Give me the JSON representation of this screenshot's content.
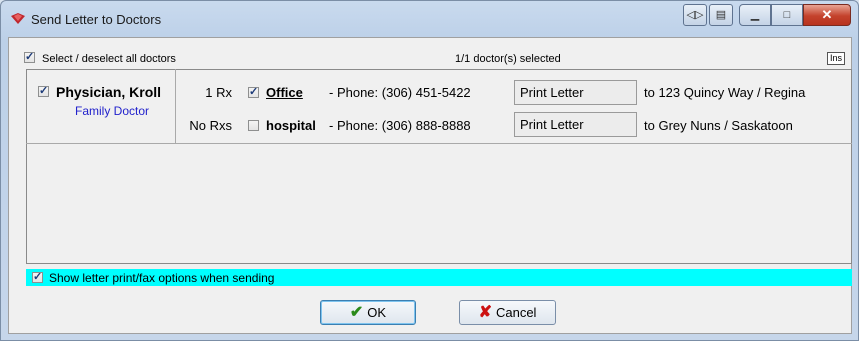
{
  "window": {
    "title": "Send Letter to Doctors"
  },
  "header": {
    "select_all_label": "Select / deselect all doctors",
    "selected_count": "1/1 doctor(s) selected",
    "ins_label": "Ins"
  },
  "doctor": {
    "name": "Physician, Kroll",
    "specialty": "Family Doctor"
  },
  "locations": [
    {
      "rx": "1 Rx",
      "name": "Office",
      "phone": "- Phone: (306) 451-5422",
      "button": "Print Letter",
      "dest": "to 123 Quincy Way / Regina"
    },
    {
      "rx": "No Rxs",
      "name": "hospital",
      "phone": "- Phone: (306) 888-8888",
      "button": "Print Letter",
      "dest": "to Grey Nuns / Saskatoon"
    }
  ],
  "options": {
    "show_options_label": "Show letter print/fax options when sending"
  },
  "buttons": {
    "ok": "OK",
    "cancel": "Cancel"
  },
  "colors": {
    "highlight": "#00ffff",
    "specialty_text": "#2222cc"
  }
}
